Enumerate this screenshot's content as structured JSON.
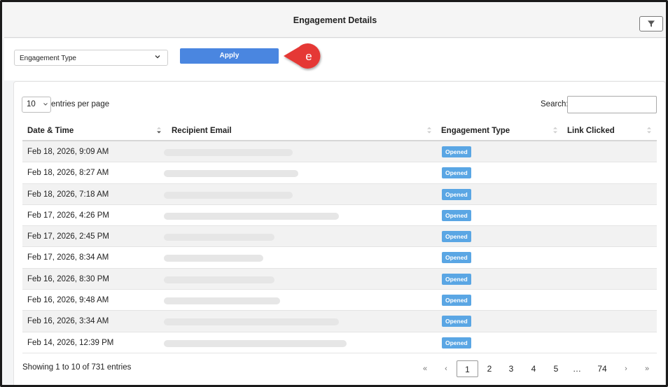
{
  "header": {
    "title": "Engagement Details",
    "filter_icon": "funnel-icon"
  },
  "filter": {
    "select_value": "Engagement Type",
    "apply_label": "Apply",
    "callout_label": "e"
  },
  "table_controls": {
    "page_length": "10",
    "length_label": "entries per page",
    "search_label": "Search:",
    "search_value": ""
  },
  "columns": [
    "Date & Time",
    "Recipient Email",
    "Engagement Type",
    "Link Clicked"
  ],
  "rows": [
    {
      "date": "Feb 18, 2026, 9:09 AM",
      "type": "Opened",
      "link": ""
    },
    {
      "date": "Feb 18, 2026, 8:27 AM",
      "type": "Opened",
      "link": ""
    },
    {
      "date": "Feb 18, 2026, 7:18 AM",
      "type": "Opened",
      "link": ""
    },
    {
      "date": "Feb 17, 2026, 4:26 PM",
      "type": "Opened",
      "link": ""
    },
    {
      "date": "Feb 17, 2026, 2:45 PM",
      "type": "Opened",
      "link": ""
    },
    {
      "date": "Feb 17, 2026, 8:34 AM",
      "type": "Opened",
      "link": ""
    },
    {
      "date": "Feb 16, 2026, 8:30 PM",
      "type": "Opened",
      "link": ""
    },
    {
      "date": "Feb 16, 2026, 9:48 AM",
      "type": "Opened",
      "link": ""
    },
    {
      "date": "Feb 16, 2026, 3:34 AM",
      "type": "Opened",
      "link": ""
    },
    {
      "date": "Feb 14, 2026, 12:39 PM",
      "type": "Opened",
      "link": ""
    }
  ],
  "footer": {
    "info": "Showing 1 to 10 of 731 entries"
  },
  "pagination": {
    "first": "«",
    "prev": "‹",
    "pages": [
      "1",
      "2",
      "3",
      "4",
      "5",
      "…",
      "74"
    ],
    "current": "1",
    "next": "›",
    "last": "»"
  },
  "colors": {
    "accent": "#4a86e0",
    "badge": "#5aa6e4",
    "callout": "#e53935"
  }
}
